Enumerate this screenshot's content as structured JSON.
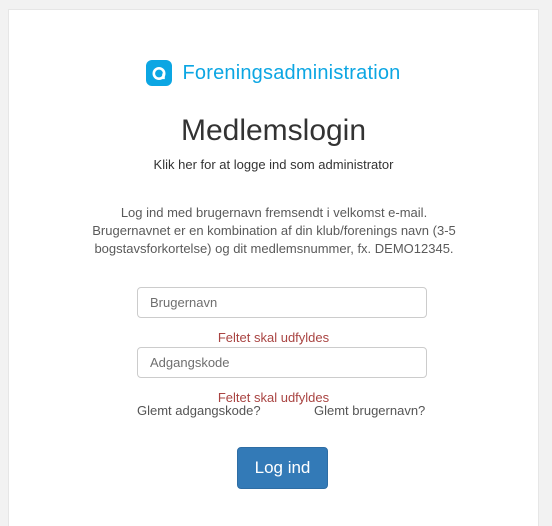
{
  "brand": {
    "name": "Foreningsadministration",
    "accent_color": "#0ca6e3",
    "icon": "a-logo-icon"
  },
  "login": {
    "title": "Medlemslogin",
    "admin_link": "Klik her for at logge ind som administrator",
    "intro": "Log ind med brugernavn fremsendt i velkomst e-mail. Brugernavnet er en kombination af din klub/forenings navn (3-5 bogstavsforkortelse) og dit medlemsnummer, fx. DEMO12345.",
    "username": {
      "placeholder": "Brugernavn",
      "value": "",
      "error": "Feltet skal udfyldes"
    },
    "password": {
      "placeholder": "Adgangskode",
      "value": "",
      "error": "Feltet skal udfyldes"
    },
    "forgot_password": "Glemt adgangskode?",
    "forgot_username": "Glemt brugernavn?",
    "submit_label": "Log ind",
    "submit_color": "#337ab7",
    "error_color": "#a94442"
  }
}
